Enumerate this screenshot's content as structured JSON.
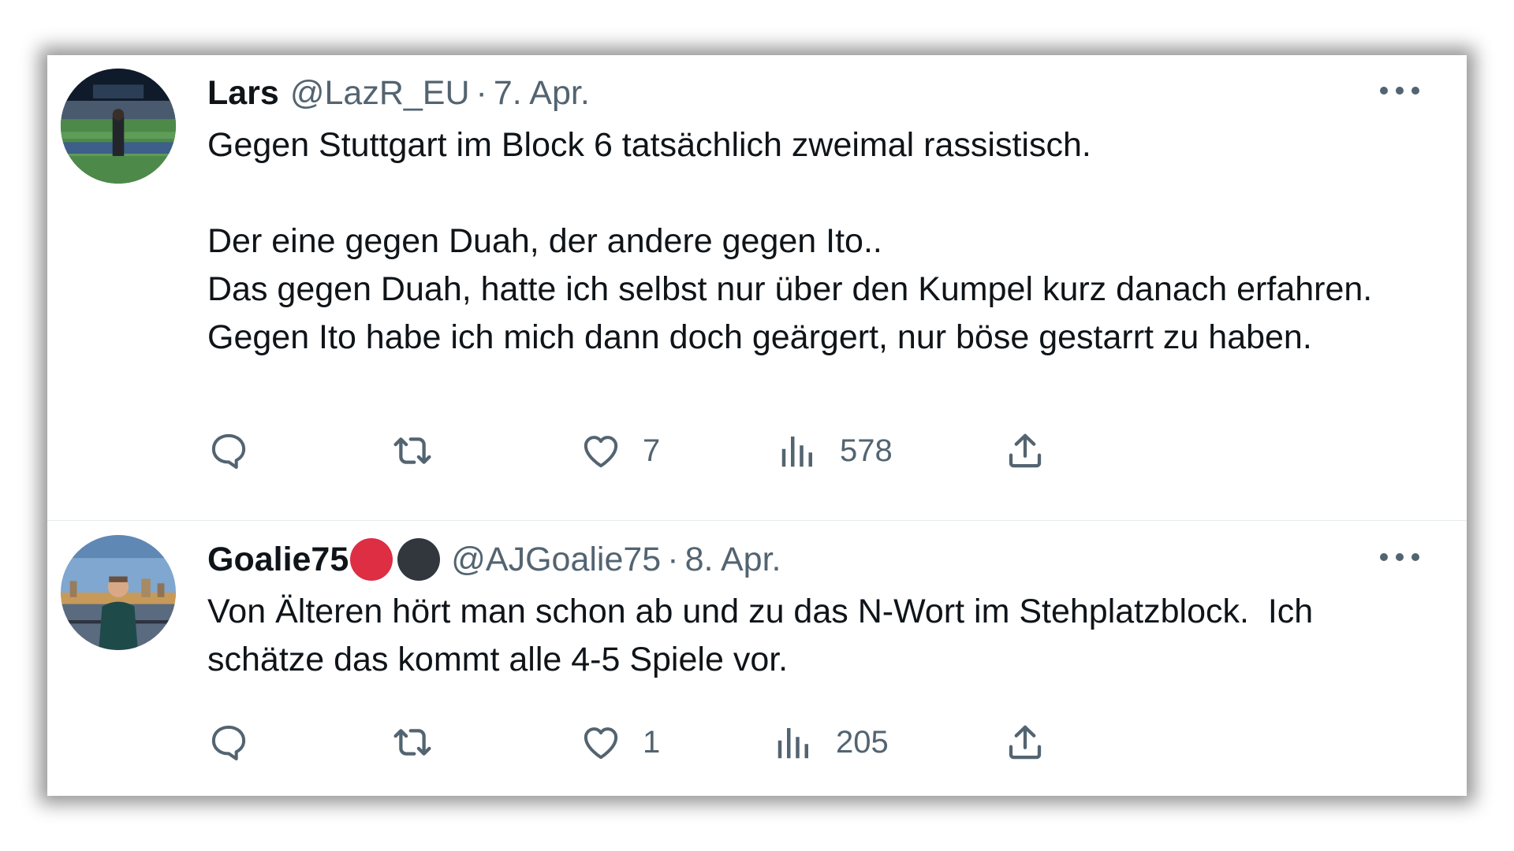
{
  "tweets": [
    {
      "author_name": "Lars",
      "handle": "@LazR_EU",
      "separator": "·",
      "date": "7. Apr.",
      "paragraphs": [
        "Gegen Stuttgart im Block 6 tatsächlich zweimal rassistisch.",
        "",
        "Der eine gegen Duah, der andere gegen Ito..",
        "Das gegen Duah, hatte ich selbst nur über den Kumpel kurz danach erfahren. Gegen Ito habe ich mich dann doch geärgert, nur böse gestarrt zu haben."
      ],
      "likes": "7",
      "views": "578"
    },
    {
      "author_name": "Goalie75",
      "handle": "@AJGoalie75",
      "separator": "·",
      "date": "8. Apr.",
      "emoji": [
        "red-circle",
        "black-circle"
      ],
      "paragraphs": [
        "Von Älteren hört man schon ab und zu das N-Wort im Stehplatzblock.  Ich schätze das kommt alle 4-5 Spiele vor."
      ],
      "likes": "1",
      "views": "205"
    }
  ],
  "icons": {
    "reply": "reply-icon",
    "retweet": "retweet-icon",
    "like": "heart-icon",
    "views": "views-icon",
    "share": "share-icon",
    "more": "more-icon"
  },
  "colors": {
    "text_primary": "#0f1419",
    "text_secondary": "#536471",
    "emoji_red": "#dd2e44",
    "emoji_black": "#31373d"
  }
}
